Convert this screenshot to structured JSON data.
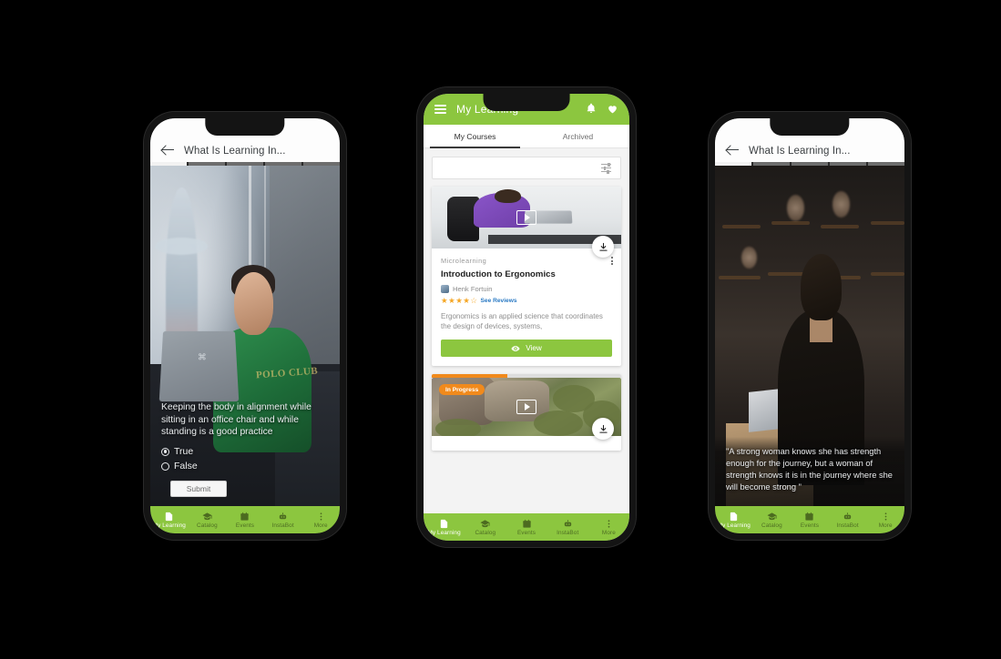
{
  "app": {
    "brand_green": "#8cc63f",
    "accent_orange": "#f18a1c",
    "link_blue": "#2a7ac4",
    "star_color": "#f5a623"
  },
  "bottom_nav": {
    "items": [
      {
        "label": "My Learning",
        "icon": "document-icon",
        "active": true
      },
      {
        "label": "Catalog",
        "icon": "graduation-cap-icon",
        "active": false
      },
      {
        "label": "Events",
        "icon": "calendar-icon",
        "active": false
      },
      {
        "label": "InstaBot",
        "icon": "robot-icon",
        "active": false
      },
      {
        "label": "More",
        "icon": "more-vertical-icon",
        "active": false
      }
    ]
  },
  "phone_left": {
    "header": {
      "title": "What Is Learning In...",
      "back_icon": "back-arrow-icon"
    },
    "progress": {
      "total_steps": 5,
      "completed_steps": 1
    },
    "quiz": {
      "question": "Keeping the body in alignment while sitting in an office chair and while standing is a good practice",
      "options": [
        {
          "label": "True",
          "selected": true
        },
        {
          "label": "False",
          "selected": false
        }
      ],
      "submit_label": "Submit"
    }
  },
  "phone_center": {
    "header": {
      "title": "My Learning",
      "menu_icon": "hamburger-icon",
      "bell_icon": "bell-icon",
      "heart_icon": "heart-icon"
    },
    "tabs": [
      {
        "label": "My Courses",
        "active": true
      },
      {
        "label": "Archived",
        "active": false
      }
    ],
    "search": {
      "value": "",
      "placeholder": "",
      "filter_icon": "filter-sliders-icon"
    },
    "cards": [
      {
        "kicker": "Microlearning",
        "title": "Introduction to Ergonomics",
        "author": "Henk Fortuin",
        "rating": 4,
        "rating_max": 5,
        "reviews_link": "See Reviews",
        "description": "Ergonomics is an applied science that coordinates the design of devices, systems,",
        "button_label": "View",
        "button_icon": "eye-icon",
        "download_icon": "download-icon",
        "menu_icon": "kebab-menu-icon",
        "play_icon": "play-video-icon"
      },
      {
        "badge": "In Progress",
        "progress_percent": 40,
        "download_icon": "download-icon",
        "play_icon": "play-video-icon"
      }
    ]
  },
  "phone_right": {
    "header": {
      "title": "What Is Learning In...",
      "back_icon": "back-arrow-icon"
    },
    "progress": {
      "total_steps": 5,
      "completed_steps": 1
    },
    "quote": "\"A strong woman knows she has strength enough for the journey, but a woman of strength knows it is in the journey where she will become strong \""
  }
}
